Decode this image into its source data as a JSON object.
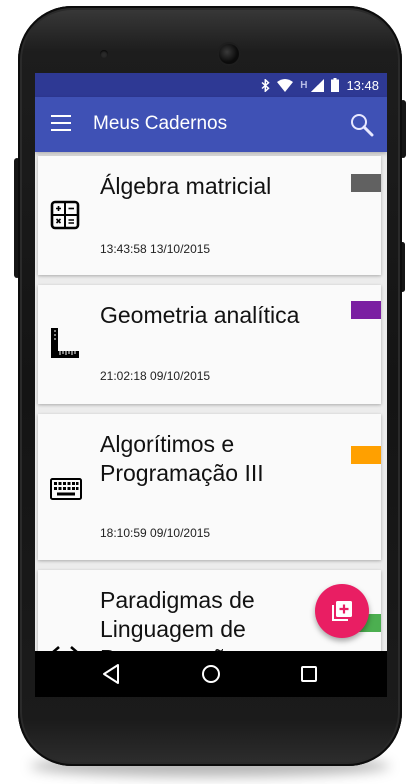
{
  "status": {
    "time": "13:48",
    "network_letter": "H",
    "icons": [
      "bluetooth-icon",
      "wifi-icon",
      "signal-icon",
      "battery-icon"
    ]
  },
  "appbar": {
    "title": "Meus Cadernos",
    "menu_icon": "hamburger-menu-icon",
    "search_icon": "search-icon"
  },
  "notebooks": [
    {
      "title": "Álgebra matricial",
      "timestamp": "13:43:58 13/10/2015",
      "icon": "calculator-icon",
      "color": "#616161"
    },
    {
      "title": "Geometria analítica",
      "timestamp": "21:02:18 09/10/2015",
      "icon": "ruler-square-icon",
      "color": "#7b1fa2"
    },
    {
      "title": "Algorítimos e Programação III",
      "timestamp": "18:10:59 09/10/2015",
      "icon": "keyboard-icon",
      "color": "#ffa000"
    },
    {
      "title": "Paradigmas de Linguagem de Programação",
      "timestamp": "",
      "icon": "code-icon",
      "color": "#4caf50"
    }
  ],
  "fab": {
    "icon": "add-notebook-icon",
    "color": "#e91e63"
  },
  "navbar": {
    "icons": [
      "back-icon",
      "home-icon",
      "recents-icon"
    ]
  },
  "colors": {
    "statusbar": "#2e3994",
    "appbar": "#3f51b5",
    "accent": "#e91e63"
  }
}
